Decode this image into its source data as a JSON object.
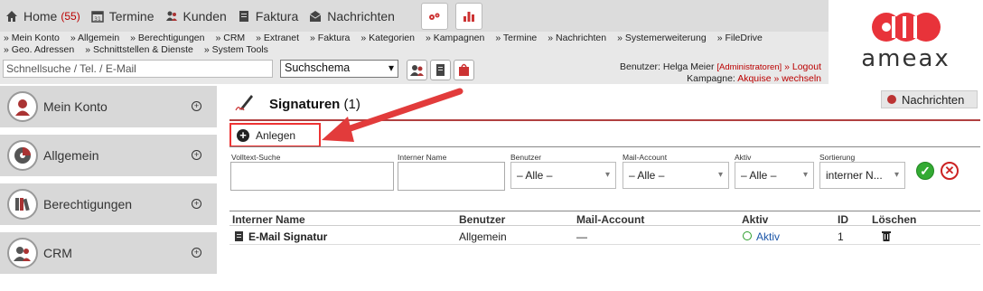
{
  "nav": {
    "home_label": "Home",
    "home_count": "(55)",
    "termine_label": "Termine",
    "kunden_label": "Kunden",
    "faktura_label": "Faktura",
    "nachrichten_label": "Nachrichten"
  },
  "links": [
    "» Mein Konto",
    "» Allgemein",
    "» Berechtigungen",
    "» CRM",
    "» Extranet",
    "» Faktura",
    "» Kategorien",
    "» Kampagnen",
    "» Termine",
    "» Nachrichten",
    "» Systemerweiterung",
    "» FileDrive",
    "» Geo. Adressen",
    "» Schnittstellen & Dienste",
    "» System Tools"
  ],
  "search": {
    "placeholder": "Schnellsuche / Tel. / E-Mail",
    "schema_value": "Suchschema"
  },
  "user": {
    "prefix": "Benutzer: Helga Meier",
    "role": "[Administratoren]",
    "logout": "» Logout",
    "kampagne_prefix": "Kampagne:",
    "kampagne_value": "Akquise",
    "wechseln": "» wechseln"
  },
  "logo": {
    "text": "ameax"
  },
  "sidebar": {
    "items": [
      {
        "label": "Mein Konto"
      },
      {
        "label": "Allgemein"
      },
      {
        "label": "Berechtigungen"
      },
      {
        "label": "CRM"
      }
    ]
  },
  "page": {
    "title": "Signaturen",
    "count": "(1)",
    "messages_button": "Nachrichten",
    "create_button": "Anlegen"
  },
  "filters": {
    "volltext_label": "Volltext-Suche",
    "interner_label": "Interner Name",
    "benutzer_label": "Benutzer",
    "benutzer_value": "– Alle –",
    "mail_label": "Mail-Account",
    "mail_value": "– Alle –",
    "aktiv_label": "Aktiv",
    "aktiv_value": "– Alle –",
    "sort_label": "Sortierung",
    "sort_value": "interner N..."
  },
  "table": {
    "headers": [
      "Interner Name",
      "Benutzer",
      "Mail-Account",
      "Aktiv",
      "ID",
      "Löschen"
    ],
    "rows": [
      {
        "name": "E-Mail Signatur",
        "benutzer": "Allgemein",
        "mail": "—",
        "aktiv": "Aktiv",
        "id": "1"
      }
    ]
  },
  "colors": {
    "accent": "#b04040",
    "highlight": "#e33333",
    "active": "#2a9d2a"
  }
}
